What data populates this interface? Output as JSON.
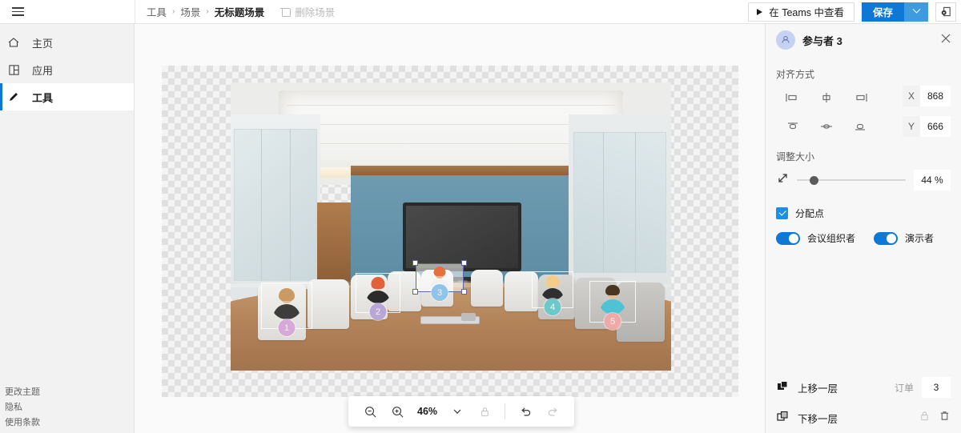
{
  "topbar": {
    "menu_icon": "hamburger-icon",
    "breadcrumb": [
      {
        "label": "工具"
      },
      {
        "label": "场景"
      },
      {
        "label": "无标题场景"
      }
    ],
    "delete_scene_label": "删除场景",
    "delete_scene_icon": "trash-icon",
    "view_in_teams_label": "在 Teams 中查看",
    "view_in_teams_icon": "play-icon",
    "save_label": "保存",
    "save_caret_icon": "chevron-down-icon",
    "share_icon": "share-screen-icon"
  },
  "sidebar": {
    "items": [
      {
        "label": "主页",
        "icon": "home-icon",
        "active": false
      },
      {
        "label": "应用",
        "icon": "apps-grid-icon",
        "active": false
      },
      {
        "label": "工具",
        "icon": "pencil-icon",
        "active": true
      }
    ],
    "footer_links": [
      {
        "label": "更改主题"
      },
      {
        "label": "隐私"
      },
      {
        "label": "使用条款"
      }
    ]
  },
  "canvas": {
    "scene_alt": "会议室场景",
    "avatars": [
      {
        "number": "1",
        "badge_color": "#d8a8d8"
      },
      {
        "number": "2",
        "badge_color": "#b9a6d9"
      },
      {
        "number": "3",
        "badge_color": "#8fc3e8",
        "selected": true
      },
      {
        "number": "4",
        "badge_color": "#6ec8c8"
      },
      {
        "number": "5",
        "badge_color": "#f0a9a9"
      }
    ]
  },
  "zoom_toolbar": {
    "zoom_out_icon": "zoom-out-icon",
    "zoom_in_icon": "zoom-in-icon",
    "zoom_value": "46%",
    "dropdown_icon": "chevron-down-icon",
    "lock_icon": "lock-icon",
    "undo_icon": "undo-icon",
    "redo_icon": "redo-icon"
  },
  "right_panel": {
    "avatar_icon": "person-icon",
    "title": "参与者 3",
    "close_icon": "close-icon",
    "align_label": "对齐方式",
    "align_buttons": [
      {
        "name": "align-left",
        "icon": "align-left-icon"
      },
      {
        "name": "align-center-horizontal",
        "icon": "align-center-h-icon"
      },
      {
        "name": "align-right",
        "icon": "align-right-icon"
      },
      {
        "name": "align-top",
        "icon": "align-top-icon"
      },
      {
        "name": "align-center-vertical",
        "icon": "align-center-v-icon"
      },
      {
        "name": "align-bottom",
        "icon": "align-bottom-icon"
      }
    ],
    "x_label": "X",
    "x_value": "868",
    "y_label": "Y",
    "y_value": "666",
    "resize_label": "调整大小",
    "resize_icon": "resize-diagonal-icon",
    "resize_percent": "44 %",
    "assign_point_label": "分配点",
    "toggles": [
      {
        "label": "会议组织者",
        "on": true
      },
      {
        "label": "演示者",
        "on": true
      }
    ],
    "layer_up_label": "上移一层",
    "layer_up_icon": "bring-forward-icon",
    "layer_down_label": "下移一层",
    "layer_down_icon": "send-backward-icon",
    "order_label": "订单",
    "order_value": "3",
    "lock_icon": "lock-icon",
    "delete_icon": "trash-icon"
  },
  "colors": {
    "accent": "#0f78d4",
    "accent_light": "#1a8fe3",
    "selection": "#6264a7"
  }
}
